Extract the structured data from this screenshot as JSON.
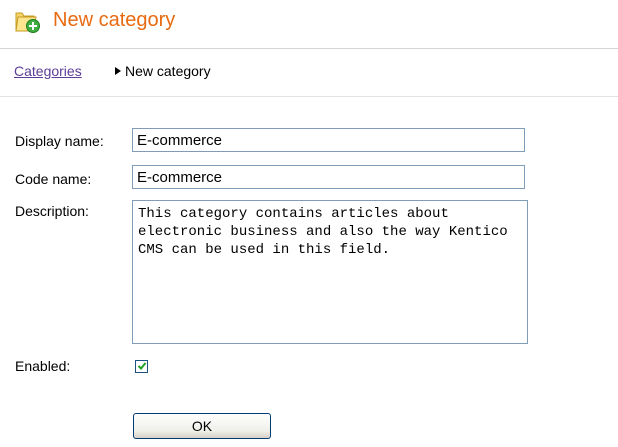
{
  "header": {
    "title": "New category",
    "icon": "folder-add-icon"
  },
  "breadcrumb": {
    "parent_label": "Categories",
    "current_label": "New category"
  },
  "form": {
    "display_name": {
      "label": "Display name:",
      "value": "E-commerce"
    },
    "code_name": {
      "label": "Code name:",
      "value": "E-commerce"
    },
    "description": {
      "label": "Description:",
      "value": "This category contains articles about electronic business and also the way Kentico CMS can be used in this field."
    },
    "enabled": {
      "label": "Enabled:",
      "checked": true
    },
    "ok_label": "OK"
  },
  "colors": {
    "title": "#e86a10",
    "link": "#5c3d99",
    "input_border": "#7f9db9",
    "check_green": "#21a121"
  }
}
